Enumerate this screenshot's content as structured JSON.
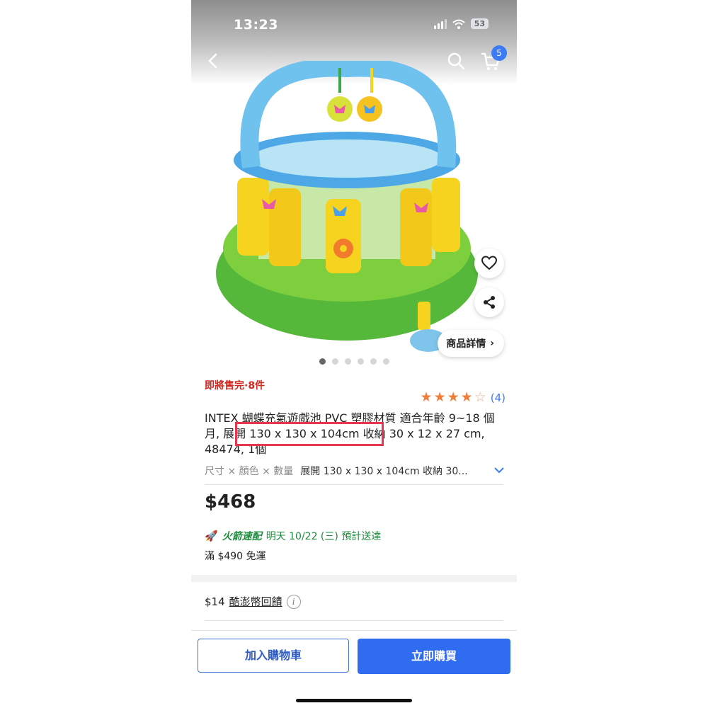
{
  "status_bar": {
    "time": "13:23",
    "battery": "53"
  },
  "nav": {
    "cart_count": "5"
  },
  "product": {
    "image_icon": "inflatable-play-pool",
    "dots_count": 6,
    "active_dot": 0,
    "detail_chip_label": "商品詳情",
    "stock_text": "即將售完·8件",
    "rating": {
      "stars": 4,
      "max": 5,
      "count": "(4)"
    },
    "title": "INTEX 蝴蝶充氣遊戲池 PVC 塑膠材質 適合年齡 9~18 個月, 展開 130 x 130 x 104cm 收納 30 x 12 x 27 cm, 48474, 1個",
    "spec_label": "尺寸 × 顏色 × 數量",
    "spec_value": "展開 130 x 130 x 104cm 收納 30...",
    "price": "$468",
    "delivery": {
      "brand": "火箭速配",
      "date": "明天 10/22 (三) 預計送達"
    },
    "shipping": "滿 $490 免運",
    "cashback": {
      "amount": "$14",
      "label": "酷澎幣回饋"
    }
  },
  "actions": {
    "add_to_cart": "加入購物車",
    "buy_now": "立即購買"
  },
  "colors": {
    "accent": "#2f6cf0",
    "stock_red": "#d0281f",
    "delivery_green": "#1c8c3c",
    "star": "#f07c3a",
    "highlight": "#e8364f"
  }
}
